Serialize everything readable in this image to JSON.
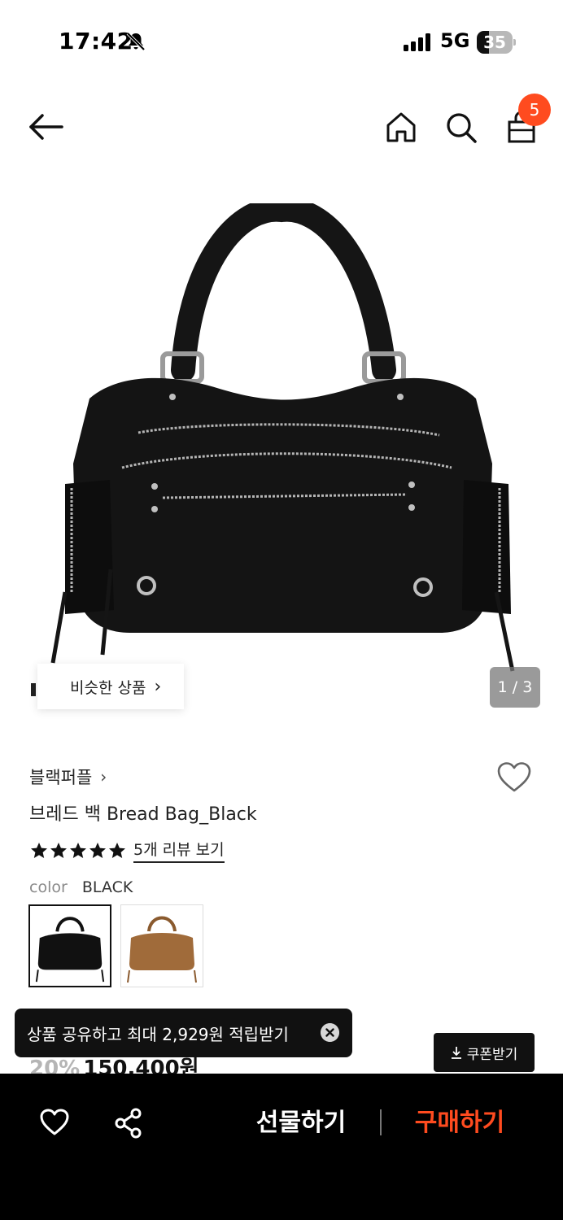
{
  "status_bar": {
    "time": "17:42",
    "network": "5G",
    "battery": "35",
    "battery_level": 0.35
  },
  "header": {
    "cart_count": "5",
    "icons": [
      "back-arrow-icon",
      "home-icon",
      "search-icon",
      "shopping-bag-icon"
    ]
  },
  "gallery": {
    "similar_label": "비슷한 상품",
    "similar_chevron": "›",
    "counter": "1 / 3"
  },
  "product": {
    "brand": "블랙퍼플",
    "brand_chevron": "›",
    "name": "브레드 백 Bread Bag_Black",
    "rating": 5,
    "review_link": "5개 리뷰 보기",
    "color_label": "color",
    "color_value": "BLACK",
    "colors": [
      "#111111",
      "#a06b3a"
    ],
    "discount": "20%",
    "price": "150,400원"
  },
  "toast": {
    "message": "상품 공유하고 최대 2,929원 적립받기"
  },
  "coupon": {
    "label": "쿠폰받기"
  },
  "bottom_bar": {
    "gift_label": "선물하기",
    "buy_label": "구매하기",
    "buy_color": "#ff4b1f"
  }
}
